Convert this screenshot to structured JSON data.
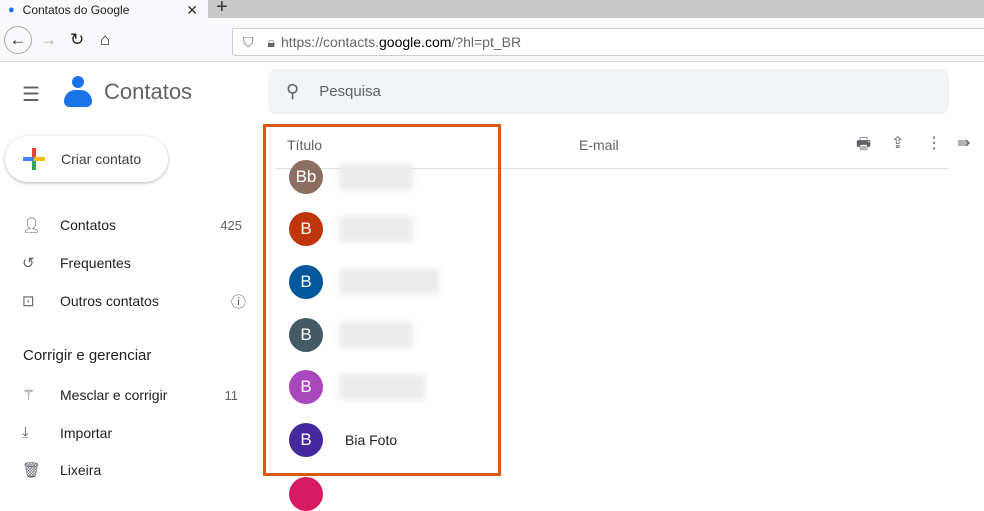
{
  "browser": {
    "tab_title": "Contatos do Google",
    "url_prefix": "https://contacts.",
    "url_domain": "google.com",
    "url_suffix": "/?hl=pt_BR"
  },
  "app": {
    "title": "Contatos",
    "search_placeholder": "Pesquisa",
    "create_label": "Criar contato"
  },
  "sidebar": {
    "items": [
      {
        "label": "Contatos",
        "count": "425"
      },
      {
        "label": "Frequentes"
      },
      {
        "label": "Outros contatos"
      }
    ],
    "section": "Corrigir e gerenciar",
    "manage": [
      {
        "label": "Mesclar e corrigir",
        "count": "11"
      },
      {
        "label": "Importar"
      },
      {
        "label": "Lixeira"
      }
    ]
  },
  "table": {
    "col_title": "Título",
    "col_email": "E-mail",
    "rows": [
      {
        "initial": "Bb",
        "color": "#8d6e63"
      },
      {
        "initial": "B",
        "color": "#c0360c"
      },
      {
        "initial": "B",
        "color": "#01579b"
      },
      {
        "initial": "B",
        "color": "#455a64"
      },
      {
        "initial": "B",
        "color": "#ab47bc"
      },
      {
        "initial": "B",
        "color": "#4527a0",
        "name": "Bia Foto"
      }
    ]
  }
}
